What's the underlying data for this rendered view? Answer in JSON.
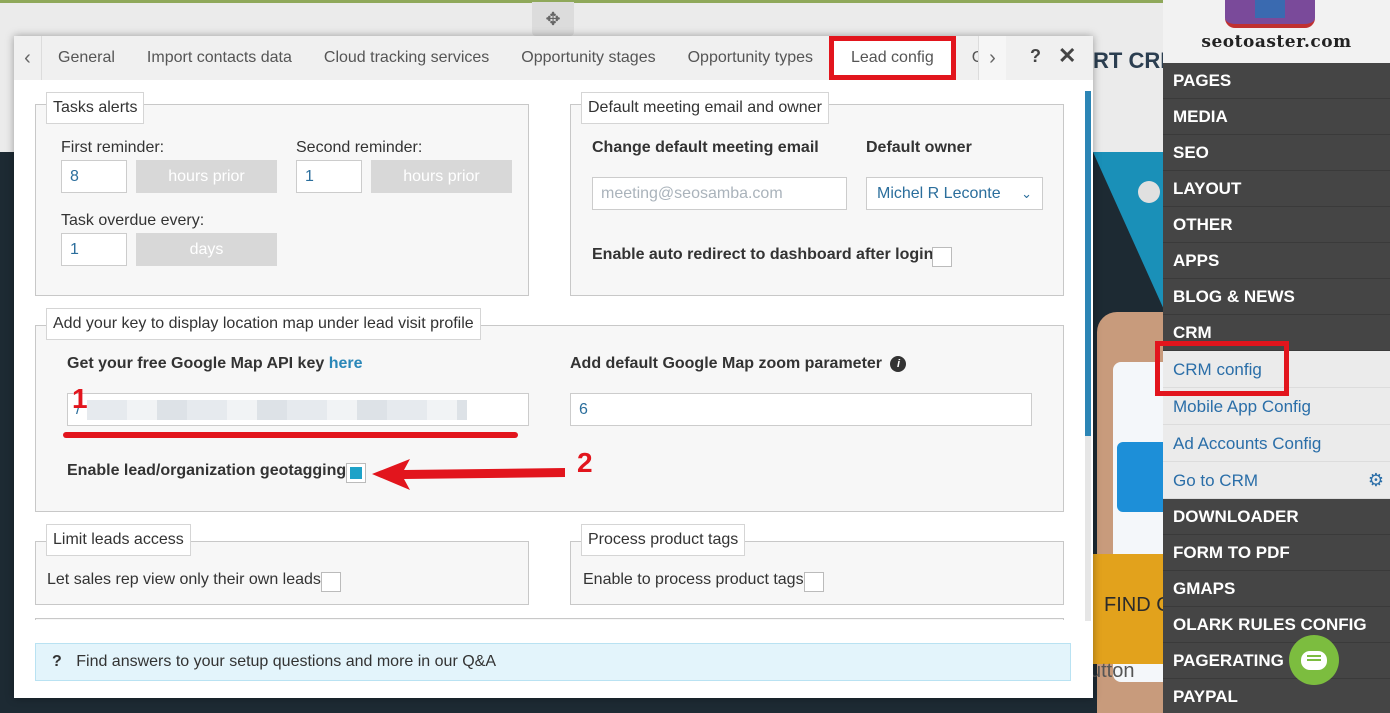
{
  "background": {
    "title_fragment": "RT CRI",
    "find_text": "FIND C",
    "button_text": "utton"
  },
  "sidebar": {
    "logo_text": "seotoaster.com",
    "items": [
      {
        "label": "PAGES"
      },
      {
        "label": "MEDIA"
      },
      {
        "label": "SEO"
      },
      {
        "label": "LAYOUT"
      },
      {
        "label": "OTHER"
      },
      {
        "label": "APPS"
      },
      {
        "label": "BLOG & NEWS"
      },
      {
        "label": "CRM"
      }
    ],
    "crm_subitems": [
      {
        "label": "CRM config"
      },
      {
        "label": "Mobile App Config"
      },
      {
        "label": "Ad Accounts Config"
      },
      {
        "label": "Go to CRM"
      }
    ],
    "items_after": [
      {
        "label": "DOWNLOADER"
      },
      {
        "label": "FORM TO PDF"
      },
      {
        "label": "GMAPS"
      },
      {
        "label": "OLARK RULES CONFIG"
      },
      {
        "label": "PAGERATING"
      },
      {
        "label": "PAYPAL"
      }
    ]
  },
  "tabs": [
    {
      "label": "General"
    },
    {
      "label": "Import contacts data"
    },
    {
      "label": "Cloud tracking services"
    },
    {
      "label": "Opportunity stages"
    },
    {
      "label": "Opportunity types"
    },
    {
      "label": "Lead config",
      "active": true
    },
    {
      "label": "Goa"
    }
  ],
  "modal": {
    "help": "?",
    "close": "✕",
    "tasks_alerts": {
      "legend": "Tasks alerts",
      "first_reminder_label": "First reminder:",
      "first_reminder_value": "8",
      "second_reminder_label": "Second reminder:",
      "second_reminder_value": "1",
      "hours_prior": "hours prior",
      "overdue_label": "Task overdue every:",
      "overdue_value": "1",
      "days": "days"
    },
    "meeting": {
      "legend": "Default meeting email and owner",
      "email_label": "Change default meeting email",
      "email_placeholder": "meeting@seosamba.com",
      "owner_label": "Default owner",
      "owner_value": "Michel R Leconte",
      "redirect_label": "Enable auto redirect to dashboard after login",
      "redirect_checked": false
    },
    "map": {
      "legend": "Add your key to display location map under lead visit profile",
      "key_label": "Get your free Google Map API key",
      "key_link": "here",
      "key_value": "/",
      "zoom_label": "Add default Google Map zoom parameter",
      "zoom_value": "6",
      "geotag_label": "Enable lead/organization geotagging",
      "geotag_checked": true
    },
    "leads_access": {
      "legend": "Limit leads access",
      "label": "Let sales rep view only their own leads",
      "checked": false
    },
    "product_tags": {
      "legend": "Process product tags",
      "label": "Enable to process product tags",
      "checked": false
    },
    "qa": {
      "icon": "?",
      "text": "Find answers to your setup questions and more in our Q&A"
    }
  },
  "annotations": {
    "one": "1",
    "two": "2",
    "highlight_color": "#e2151d"
  }
}
